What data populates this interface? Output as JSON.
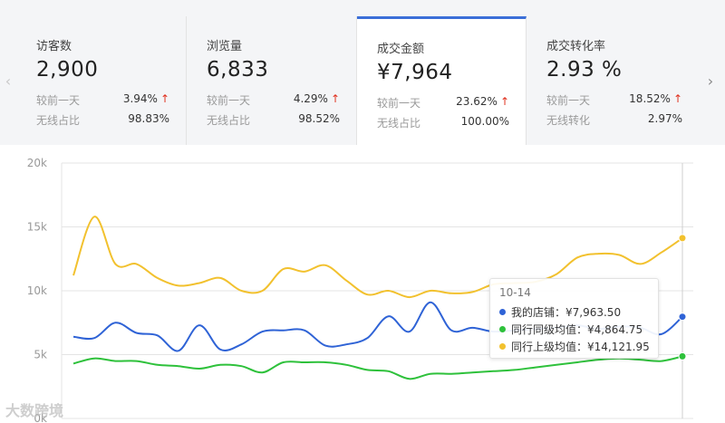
{
  "nav": {
    "prev_icon": "chevron-left",
    "next_icon": "chevron-right"
  },
  "cards": [
    {
      "label": "访客数",
      "value": "2,900",
      "row1_label": "较前一天",
      "row1_value": "3.94%",
      "row1_trend": "↑",
      "row2_label": "无线占比",
      "row2_value": "98.83%"
    },
    {
      "label": "浏览量",
      "value": "6,833",
      "row1_label": "较前一天",
      "row1_value": "4.29%",
      "row1_trend": "↑",
      "row2_label": "无线占比",
      "row2_value": "98.52%"
    },
    {
      "label": "成交金额",
      "value": "¥7,964",
      "row1_label": "较前一天",
      "row1_value": "23.62%",
      "row1_trend": "↑",
      "row2_label": "无线占比",
      "row2_value": "100.00%"
    },
    {
      "label": "成交转化率",
      "value": "2.93 %",
      "row1_label": "较前一天",
      "row1_value": "18.52%",
      "row1_trend": "↑",
      "row2_label": "无线转化",
      "row2_value": "2.97%"
    }
  ],
  "active_card": 2,
  "colors": {
    "accent": "#3b6fd8",
    "trend_up": "#e0301e",
    "blue": "#2f63d6",
    "green": "#2ec13b",
    "yellow": "#f2c12e"
  },
  "chart_data": {
    "type": "line",
    "yticks": [
      "20k",
      "15k",
      "10k",
      "5k",
      "0k"
    ],
    "ylim": [
      0,
      20000
    ],
    "grid": true,
    "series": [
      {
        "name": "我的店铺",
        "color": "#2f63d6",
        "values": [
          6400,
          6300,
          7500,
          6700,
          6500,
          5300,
          7300,
          5400,
          5800,
          6800,
          6900,
          6900,
          5700,
          5800,
          6300,
          8000,
          6800,
          9100,
          6900,
          7100,
          6800,
          6900,
          7000,
          7100,
          7300,
          7000,
          7200,
          7100,
          6600,
          7964
        ]
      },
      {
        "name": "同行同级均值",
        "color": "#2ec13b",
        "values": [
          4300,
          4700,
          4500,
          4500,
          4200,
          4100,
          3900,
          4200,
          4100,
          3600,
          4400,
          4400,
          4400,
          4200,
          3800,
          3700,
          3100,
          3500,
          3500,
          3600,
          3700,
          3800,
          4000,
          4200,
          4400,
          4600,
          4700,
          4600,
          4500,
          4865
        ]
      },
      {
        "name": "同行上级均值",
        "color": "#f2c12e",
        "values": [
          11200,
          15800,
          12100,
          12100,
          11000,
          10400,
          10600,
          11000,
          10000,
          10000,
          11700,
          11500,
          12000,
          10800,
          9700,
          10000,
          9500,
          10000,
          9800,
          9900,
          10500,
          10600,
          10700,
          11300,
          12600,
          12900,
          12800,
          12100,
          13000,
          14122
        ]
      }
    ]
  },
  "tooltip": {
    "date": "10-14",
    "rows": [
      {
        "text": "我的店铺：¥7,963.50",
        "color": "#2f63d6"
      },
      {
        "text": "同行同级均值：¥4,864.75",
        "color": "#2ec13b"
      },
      {
        "text": "同行上级均值：¥14,121.95",
        "color": "#f2c12e"
      }
    ]
  },
  "watermark": "大数跨境"
}
